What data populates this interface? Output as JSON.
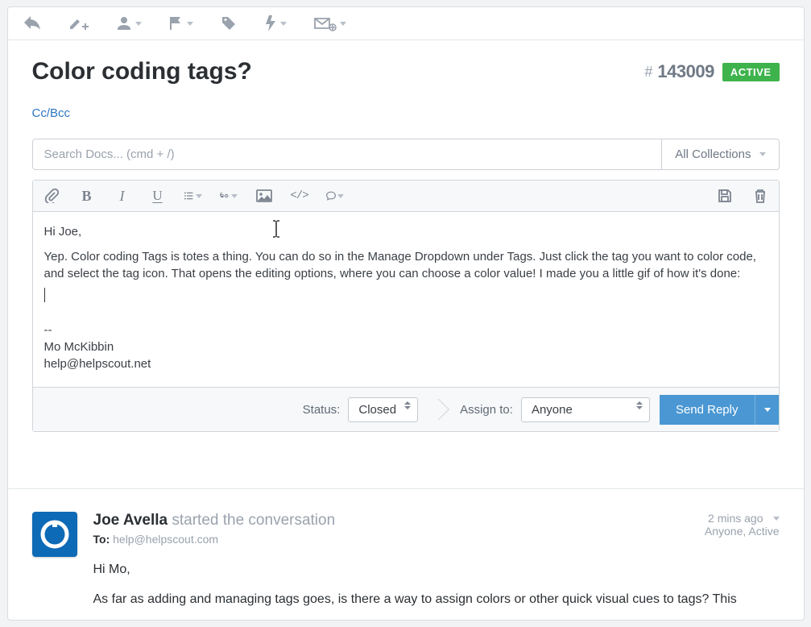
{
  "header": {
    "title": "Color coding tags?",
    "ticket_number": "143009",
    "status_badge": "ACTIVE",
    "ccbcc": "Cc/Bcc"
  },
  "search": {
    "placeholder": "Search Docs... (cmd + /)",
    "collections_label": "All Collections"
  },
  "editor": {
    "greeting": "Hi Joe,",
    "body": "Yep. Color coding Tags is totes a thing. You can do so in the Manage Dropdown under Tags. Just click the tag you want to color code, and select the tag icon. That opens the editing options, where you can choose a color value! I made you a little gif of how it's done:",
    "sig_divider": "--",
    "sig_name": "Mo McKibbin",
    "sig_email": "help@helpscout.net"
  },
  "footer": {
    "status_label": "Status:",
    "status_value": "Closed",
    "assign_label": "Assign to:",
    "assign_value": "Anyone",
    "send_label": "Send Reply"
  },
  "thread": {
    "author": "Joe Avella",
    "action": "started the conversation",
    "to_label": "To:",
    "to_value": "help@helpscout.com",
    "timestamp": "2 mins ago",
    "meta": "Anyone, Active",
    "greeting": "Hi Mo,",
    "body": "As far as adding and managing tags goes, is there a way to assign colors or other quick visual cues to tags? This"
  }
}
